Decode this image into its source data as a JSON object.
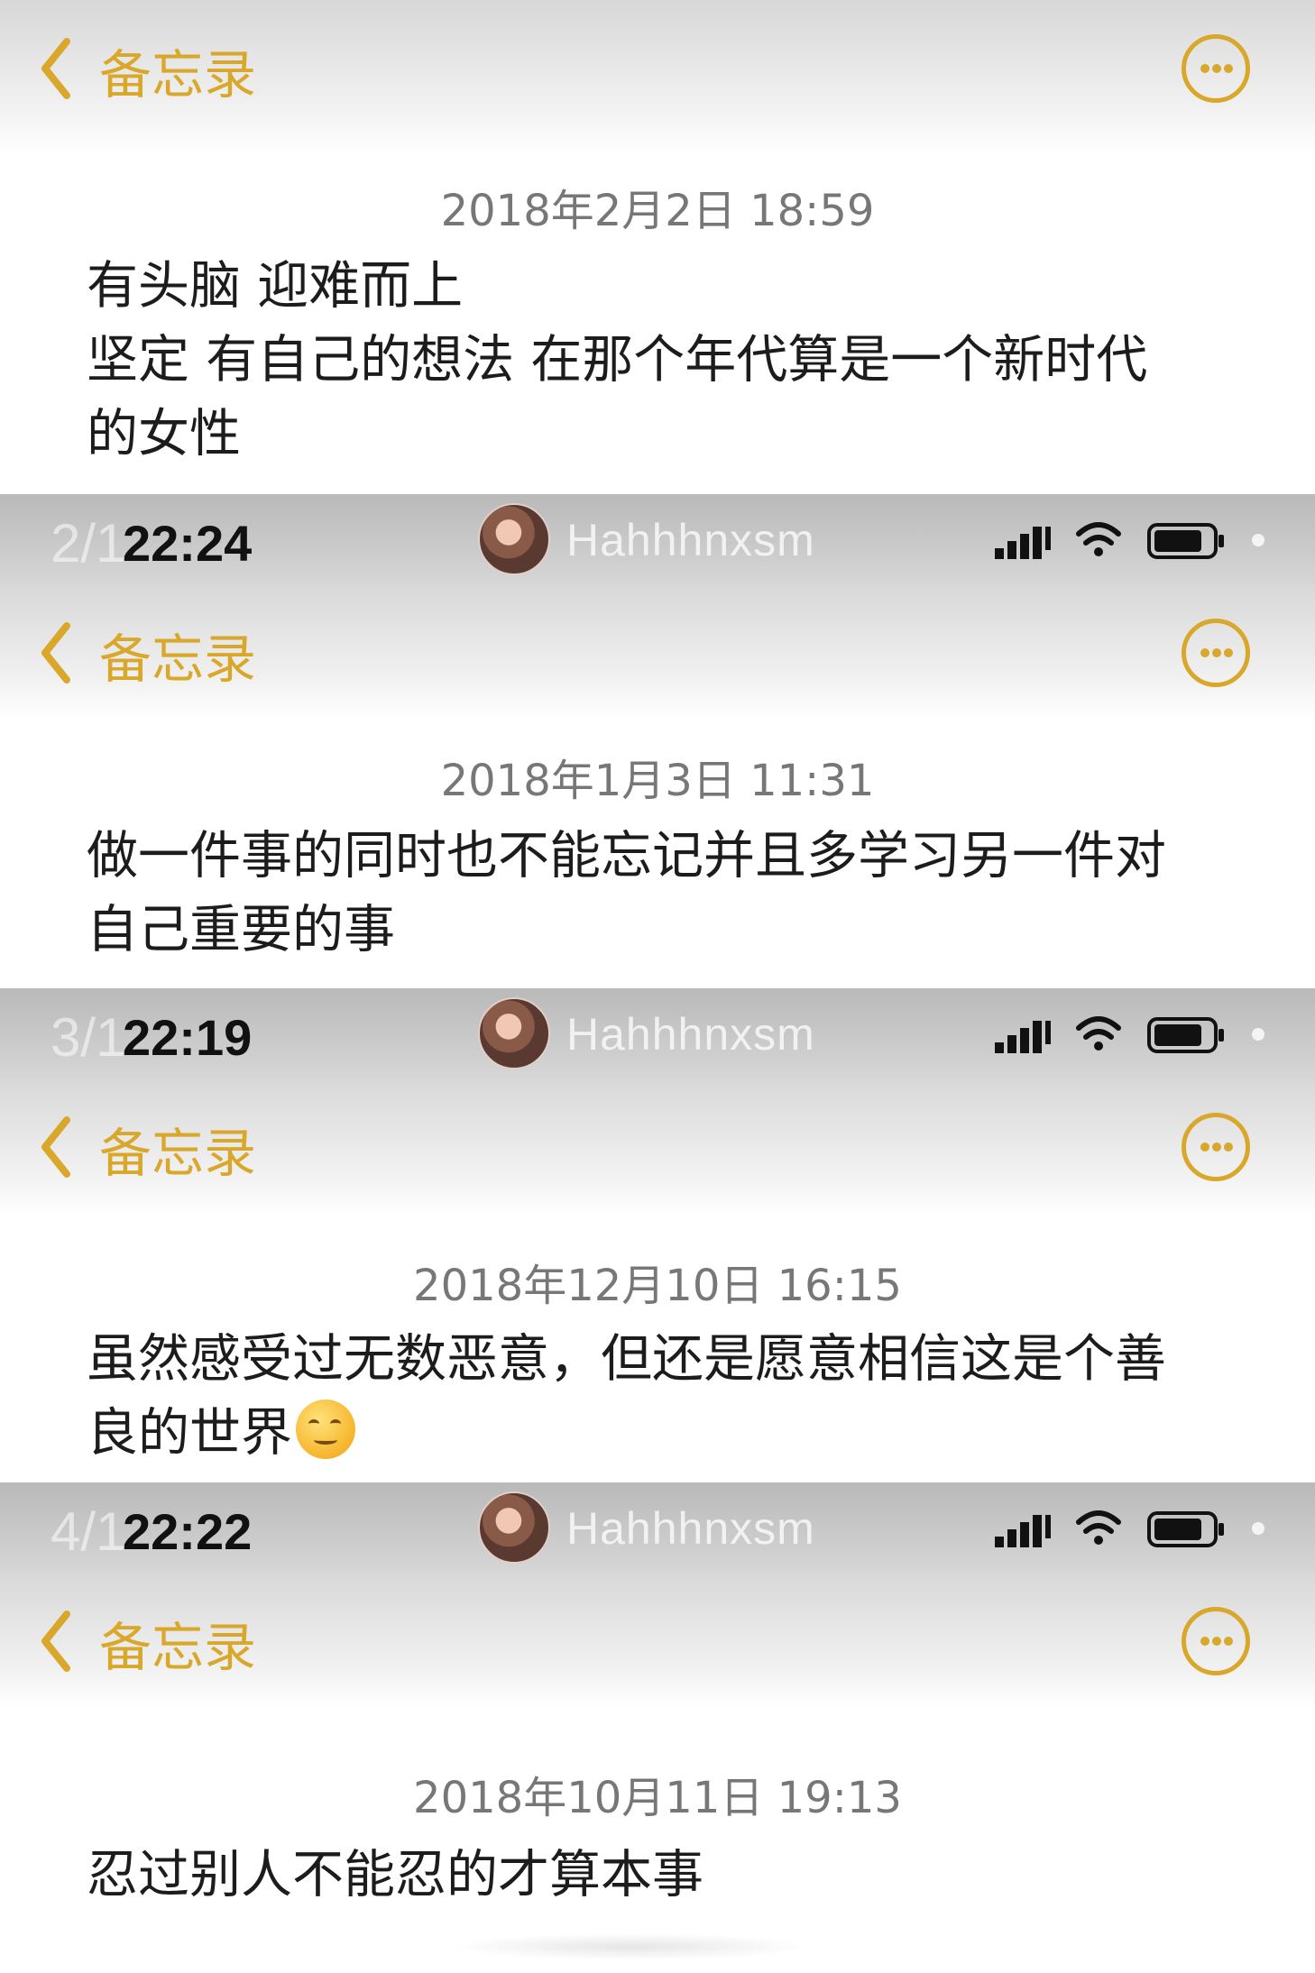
{
  "nav": {
    "back_label": "备忘录"
  },
  "status": {
    "username": "Hahhhnxsm"
  },
  "panels": [
    {
      "date": "2018年2月2日 18:59",
      "lines": [
        "有头脑 迎难而上",
        "坚定 有自己的想法 在那个年代算是一个新时代",
        "的女性"
      ]
    },
    {
      "index": "2/1",
      "time": "22:24",
      "date": "2018年1月3日 11:31",
      "lines": [
        "做一件事的同时也不能忘记并且多学习另一件对",
        "自己重要的事"
      ]
    },
    {
      "index": "3/1",
      "time": "22:19",
      "date": "2018年12月10日 16:15",
      "lines": [
        "虽然感受过无数恶意，但还是愿意相信这是个善",
        "良的世界"
      ],
      "emoji": "smiling-face-emoji"
    },
    {
      "index": "4/1",
      "time": "22:22",
      "date": "2018年10月11日 19:13",
      "lines": [
        "忍过别人不能忍的才算本事"
      ]
    }
  ],
  "colors": {
    "accent": "#d9a72a",
    "date_text": "#777777",
    "body_text": "#1c1c1c"
  },
  "icons": [
    "back-chevron-icon",
    "more-options-icon",
    "signal-icon",
    "wifi-icon",
    "battery-icon"
  ]
}
